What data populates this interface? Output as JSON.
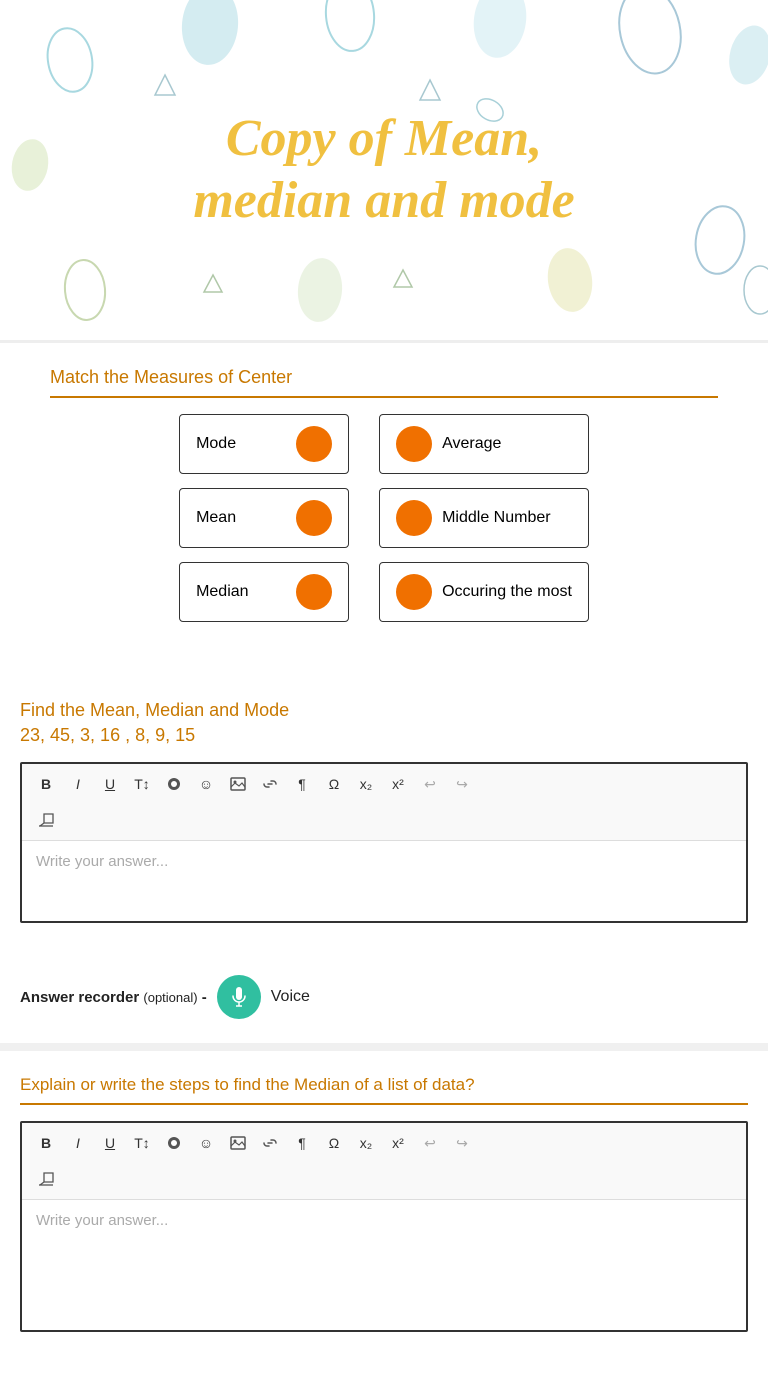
{
  "hero": {
    "title_line1": "Copy of Mean,",
    "title_line2": "median and mode"
  },
  "match_section": {
    "title": "Match the Measures of Center",
    "left_items": [
      "Mode",
      "Mean",
      "Median"
    ],
    "right_items": [
      "Average",
      "Middle Number",
      "Occuring the most"
    ]
  },
  "find_section": {
    "title": "Find the Mean,  Median  and Mode",
    "numbers": "23, 45, 3, 16 , 8, 9, 15",
    "placeholder": "Write your answer..."
  },
  "toolbar": {
    "bold": "B",
    "italic": "I",
    "underline": "U",
    "text_size": "T↕",
    "color": "🎨",
    "emoji": "☺",
    "image": "🖼",
    "link": "🔗",
    "paragraph": "¶→",
    "omega": "Ω",
    "subscript": "x₂",
    "superscript": "x²",
    "undo": "↩",
    "redo": "↪",
    "erase": "✏"
  },
  "recorder": {
    "label": "Answer recorder",
    "optional": "(optional)",
    "dash": "-",
    "voice_label": "Voice"
  },
  "explain_section": {
    "title": "Explain or write the steps to find the Median of a list of data?",
    "placeholder": "Write your answer..."
  }
}
